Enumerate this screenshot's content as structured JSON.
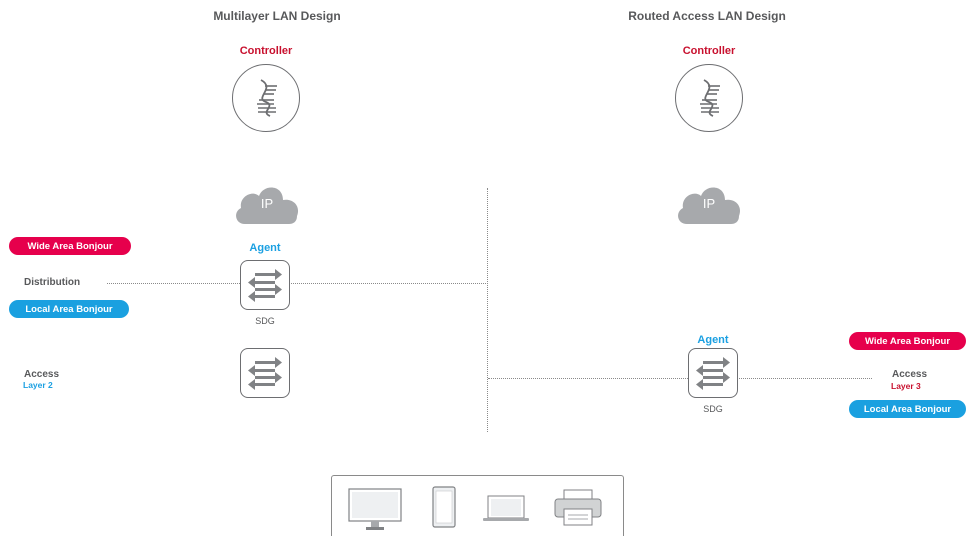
{
  "left": {
    "title": "Multilayer LAN Design",
    "controller_label": "Controller",
    "cloud_label": "IP",
    "agent_label": "Agent",
    "sdg_label": "SDG",
    "wide_area": "Wide Area Bonjour",
    "local_area": "Local Area Bonjour",
    "distribution": "Distribution",
    "access": "Access",
    "access_layer": "Layer 2"
  },
  "right": {
    "title": "Routed Access LAN Design",
    "controller_label": "Controller",
    "cloud_label": "IP",
    "agent_label": "Agent",
    "sdg_label": "SDG",
    "wide_area": "Wide Area Bonjour",
    "local_area": "Local Area Bonjour",
    "access": "Access",
    "access_layer": "Layer 3"
  },
  "colors": {
    "controller_red": "#c8102e",
    "agent_blue": "#1ba0e2",
    "pill_red": "#e6004c",
    "pill_blue": "#1aa0e0",
    "icon_gray": "#a7a9ac"
  },
  "devices": [
    "monitor-icon",
    "tablet-icon",
    "laptop-icon",
    "printer-icon"
  ]
}
